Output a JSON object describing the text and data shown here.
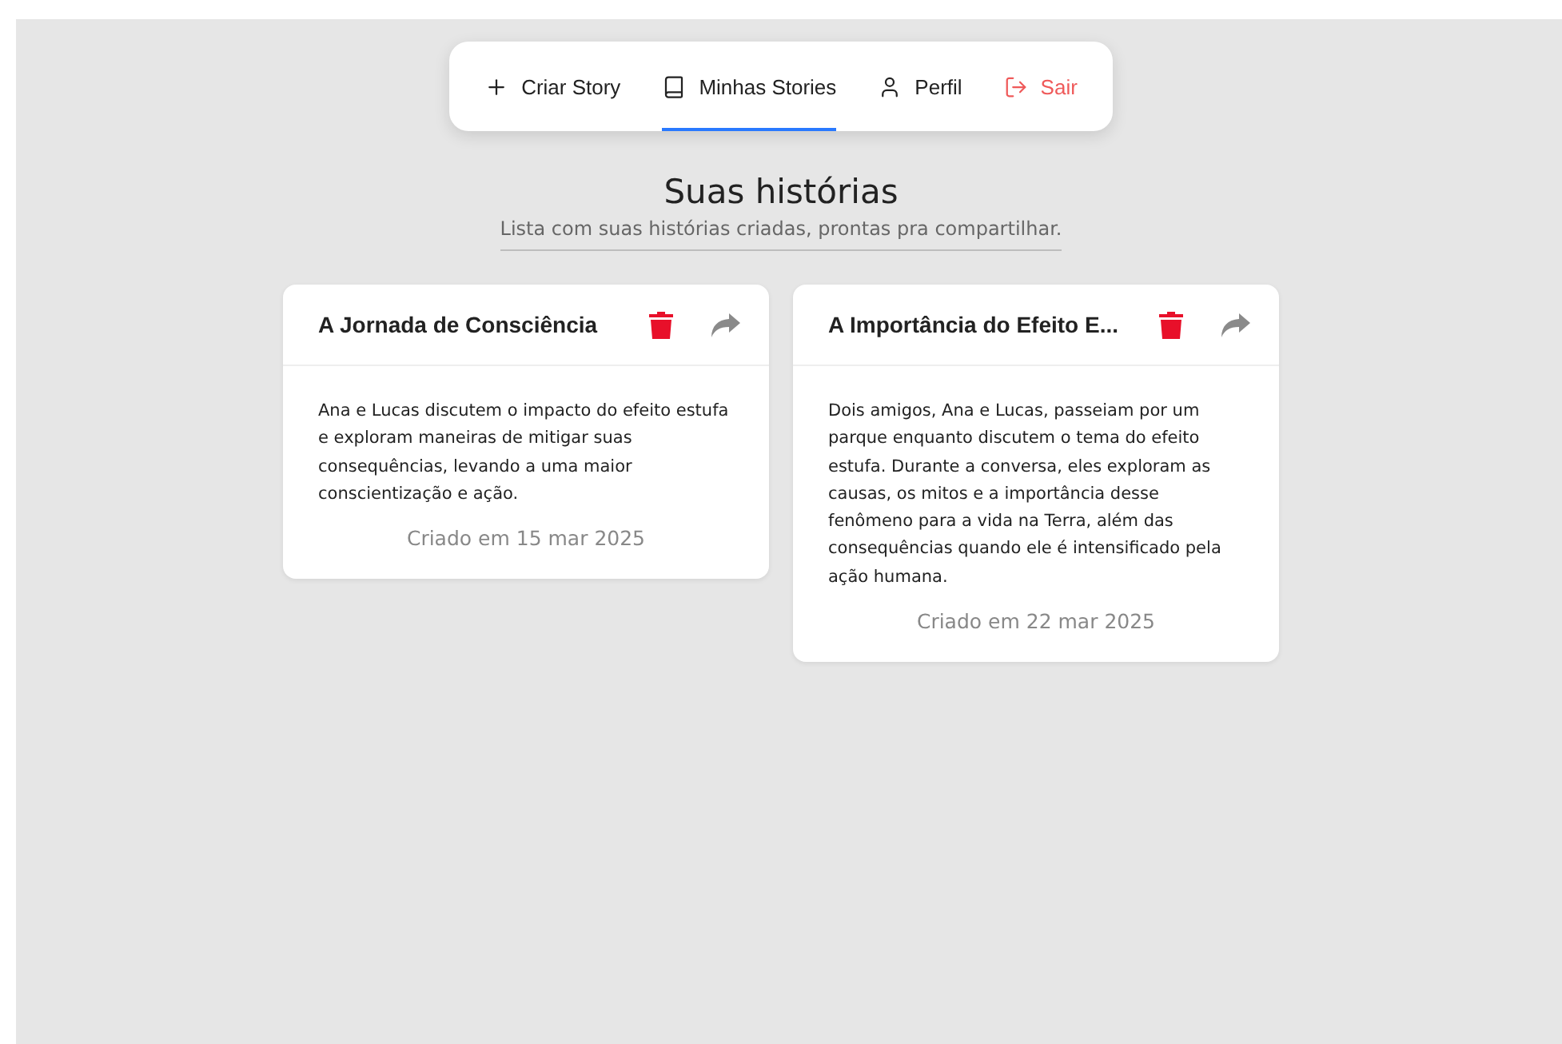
{
  "nav": [
    {
      "kind": "create",
      "label": "Criar Story",
      "selected": false
    },
    {
      "kind": "stories",
      "label": "Minhas Stories",
      "selected": true
    },
    {
      "kind": "profile",
      "label": "Perfil",
      "selected": false
    },
    {
      "kind": "logout",
      "label": "Sair",
      "selected": false
    }
  ],
  "header": {
    "title": "Suas histórias",
    "subtitle": "Lista com suas histórias criadas, prontas pra compartilhar."
  },
  "stories": [
    {
      "title": "A Jornada de Consciência",
      "summary": "Ana e Lucas discutem o impacto do efeito estufa e exploram maneiras de mitigar suas consequências, levando a uma maior conscientização e ação.",
      "created": "Criado em 15 mar 2025"
    },
    {
      "title": "A Importância do Efeito E...",
      "summary": "Dois amigos, Ana e Lucas, passeiam por um parque enquanto discutem o tema do efeito estufa. Durante a conversa, eles exploram as causas, os mitos e a importância desse fenômeno para a vida na Terra, além das consequências quando ele é intensificado pela ação humana.",
      "created": "Criado em 22 mar 2025"
    }
  ]
}
